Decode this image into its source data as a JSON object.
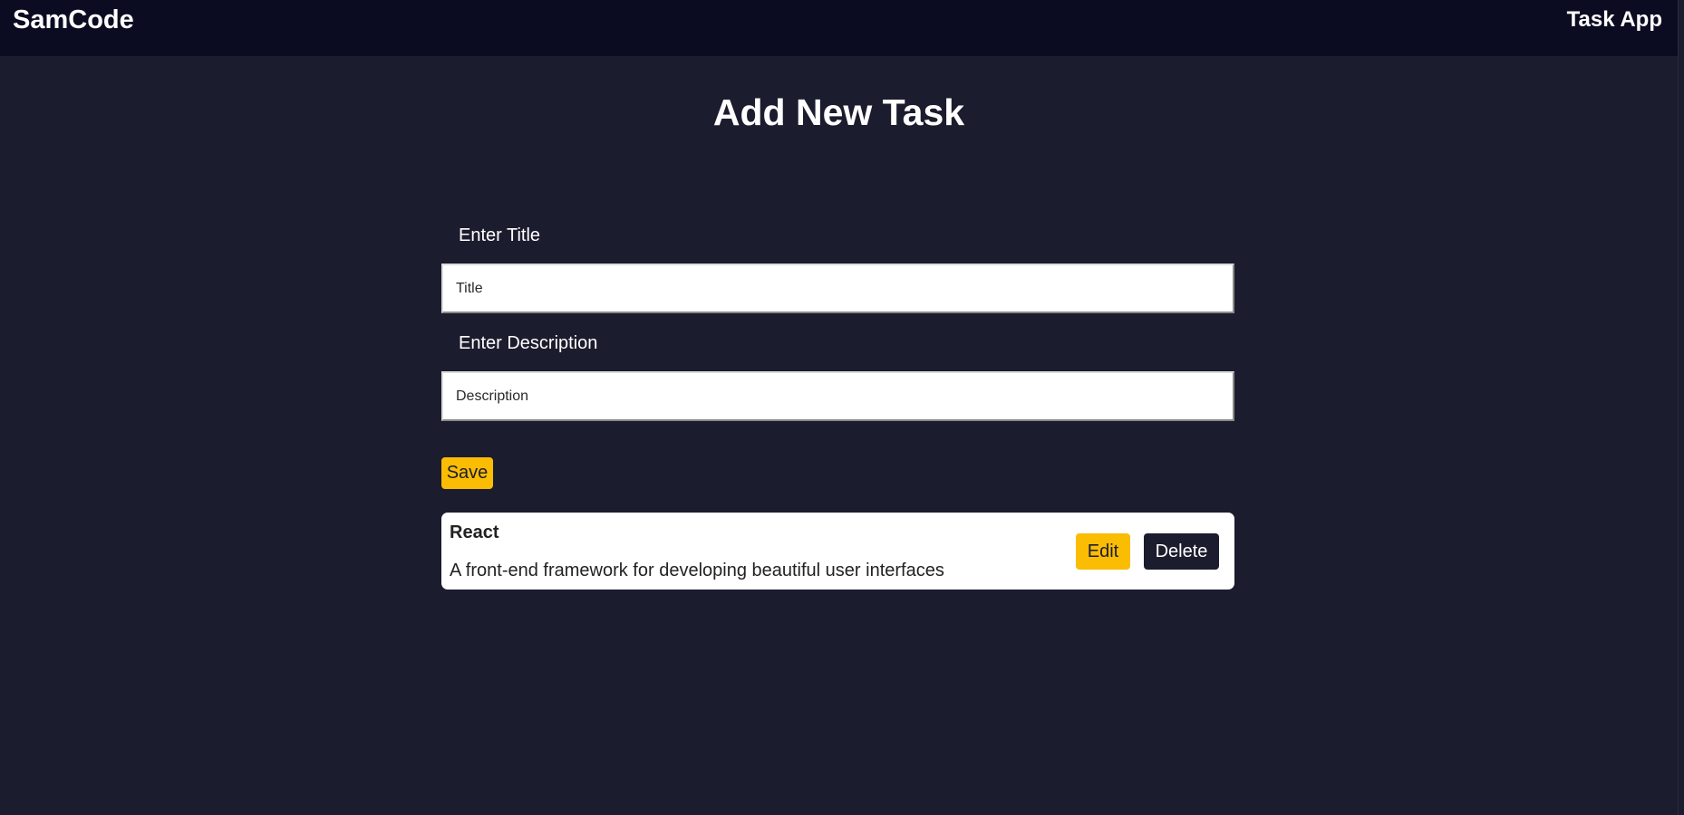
{
  "header": {
    "brand": "SamCode",
    "app_name": "Task App"
  },
  "main": {
    "title": "Add New Task",
    "title_field": {
      "label": "Enter Title",
      "placeholder": "Title",
      "value": ""
    },
    "description_field": {
      "label": "Enter Description",
      "placeholder": "Description",
      "value": ""
    },
    "save_label": "Save"
  },
  "tasks": [
    {
      "title": "React",
      "description": "A front-end framework for developing beautiful user interfaces",
      "edit_label": "Edit",
      "delete_label": "Delete"
    }
  ],
  "colors": {
    "background": "#1c1c2f",
    "header_background": "#0b0c21",
    "accent": "#fbbc04",
    "card_background": "#ffffff"
  }
}
